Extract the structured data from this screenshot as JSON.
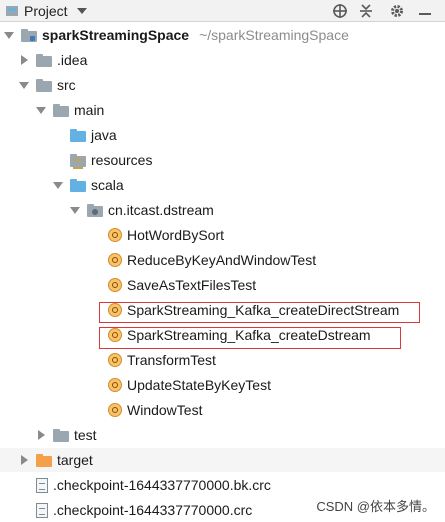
{
  "panel": {
    "title": "Project",
    "buttons": [
      {
        "name": "locate-icon",
        "glyph": "⊕"
      },
      {
        "name": "collapse-all-icon",
        "glyph": "⇅"
      },
      {
        "name": "gear-icon",
        "glyph": "⚙"
      },
      {
        "name": "hide-icon",
        "glyph": "—"
      }
    ]
  },
  "tree": [
    {
      "label": "sparkStreamingSpace",
      "path": "~/sparkStreamingSpace"
    },
    {
      "label": ".idea"
    },
    {
      "label": "src"
    },
    {
      "label": "main"
    },
    {
      "label": "java"
    },
    {
      "label": "resources"
    },
    {
      "label": "scala"
    },
    {
      "label": "cn.itcast.dstream"
    },
    {
      "label": "HotWordBySort"
    },
    {
      "label": "ReduceByKeyAndWindowTest"
    },
    {
      "label": "SaveAsTextFilesTest"
    },
    {
      "label": "SparkStreaming_Kafka_createDirectStream"
    },
    {
      "label": "SparkStreaming_Kafka_createDstream"
    },
    {
      "label": "TransformTest"
    },
    {
      "label": "UpdateStateByKeyTest"
    },
    {
      "label": "WindowTest"
    },
    {
      "label": "test"
    },
    {
      "label": "target"
    },
    {
      "label": ".checkpoint-1644337770000.bk.crc"
    },
    {
      "label": ".checkpoint-1644337770000.crc"
    }
  ],
  "highlight_color": "#d83a3a",
  "watermark": "CSDN @依本多情。"
}
